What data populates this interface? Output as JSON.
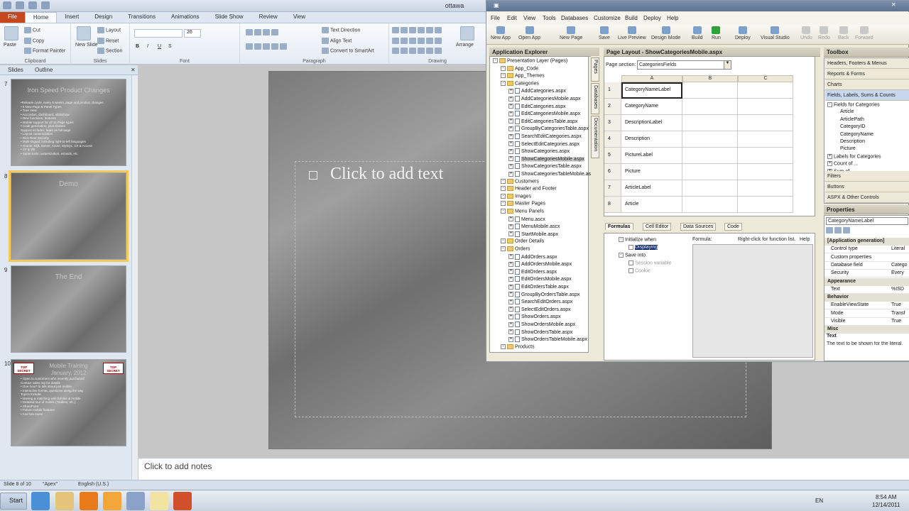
{
  "powerpoint": {
    "title": "ottawa",
    "tabs": [
      "File",
      "Home",
      "Insert",
      "Design",
      "Transitions",
      "Animations",
      "Slide Show",
      "Review",
      "View"
    ],
    "ribbon": {
      "paste": "Paste",
      "cut": "Cut",
      "copy": "Copy",
      "format_painter": "Format Painter",
      "clipboard_label": "Clipboard",
      "new_slide": "New Slide",
      "layout": "Layout",
      "reset": "Reset",
      "section": "Section",
      "slides_label": "Slides",
      "font_label": "Font",
      "paragraph_label": "Paragraph",
      "text_direction": "Text Direction",
      "align_text": "Align Text",
      "convert_smartart": "Convert to SmartArt",
      "arrange": "Arrange",
      "drawing_label": "Drawing",
      "font_size": "26"
    },
    "pane_tabs": [
      "Slides",
      "Outline"
    ],
    "slides": [
      {
        "num": "7",
        "title": "Iron Speed Product Changes",
        "lines": [
          "•Release cycle, every 6 weeks, page and product changes",
          "• 6 New Page & Panel Types",
          "• Tree View",
          "• Accordion, dashboard, slideshow",
          "• New functions, features",
          "• Mobile support for all 31 Page types",
          "• Code generation, plus classes",
          "Support includes, learn as full-page",
          "• Layout customization",
          "• Rich Reel Security",
          "• Multi-lingual, including right-to-left languages",
          "• Oracle, SQL Server, Azure, MySQL, C# & Access",
          "• C# & VB",
          "• Same tools customization, wizards, etc"
        ]
      },
      {
        "num": "8",
        "title": "Demo",
        "lines": []
      },
      {
        "num": "9",
        "title": "The End",
        "lines": []
      },
      {
        "num": "10",
        "title": "Mobile Training\nJanuary, 2012",
        "lines": [
          "• Open to customers who recently purchased",
          "  Contact sales rep for details",
          "• One hour* to talk about just mobile",
          "• Interactive format, questions along the way",
          "Topics Include:",
          "• Moving & matching web full site & mobile",
          "• Detailed tour of mobile (Toolbox, etc.)",
          "• SharePoint",
          "• Future mobile features",
          "• And lots more!"
        ],
        "badge": "TOP SECRET"
      }
    ],
    "slide_placeholder": "Click to add text",
    "notes_placeholder": "Click to add notes",
    "status": {
      "slide": "Slide 8 of 10",
      "theme": "\"Apex\"",
      "language": "English (U.S.)"
    },
    "taskbar": {
      "start": "Start",
      "lang": "EN",
      "time": "8:54 AM",
      "date": "12/14/2011"
    }
  },
  "app": {
    "menu": [
      "File",
      "Edit",
      "View",
      "Tools",
      "Databases",
      "Customize",
      "Build",
      "Deploy",
      "Help"
    ],
    "toolbar": [
      "New App",
      "Open App",
      "New Page",
      "Save",
      "Live Preview",
      "Design Mode",
      "Build",
      "Run",
      "Deploy",
      "Visual Studio",
      "Undo",
      "Redo",
      "Back",
      "Forward"
    ],
    "explorer_title": "Application Explorer",
    "layout_title": "Page Layout - ShowCategoriesMobile.aspx",
    "page_section_label": "Page section:",
    "page_section_value": "CategoriesFields",
    "tree": [
      {
        "lvl": 0,
        "t": "Presentation Layer (Pages)",
        "k": "fd"
      },
      {
        "lvl": 1,
        "t": "App_Code",
        "k": "fd"
      },
      {
        "lvl": 1,
        "t": "App_Themes",
        "k": "fd"
      },
      {
        "lvl": 1,
        "t": "Categories",
        "k": "fd"
      },
      {
        "lvl": 2,
        "t": "AddCategories.aspx",
        "k": "fl"
      },
      {
        "lvl": 2,
        "t": "AddCategoriesMobile.aspx",
        "k": "fl"
      },
      {
        "lvl": 2,
        "t": "EditCategories.aspx",
        "k": "fl"
      },
      {
        "lvl": 2,
        "t": "EditCategoriesMobile.aspx",
        "k": "fl"
      },
      {
        "lvl": 2,
        "t": "EditCategoriesTable.aspx",
        "k": "fl"
      },
      {
        "lvl": 2,
        "t": "GroupByCategoriesTable.aspx",
        "k": "fl"
      },
      {
        "lvl": 2,
        "t": "SearchEditCategories.aspx",
        "k": "fl"
      },
      {
        "lvl": 2,
        "t": "SelectEditCategories.aspx",
        "k": "fl"
      },
      {
        "lvl": 2,
        "t": "ShowCategories.aspx",
        "k": "fl"
      },
      {
        "lvl": 2,
        "t": "ShowCategoriesMobile.aspx",
        "k": "fl",
        "sel": true
      },
      {
        "lvl": 2,
        "t": "ShowCategoriesTable.aspx",
        "k": "fl"
      },
      {
        "lvl": 2,
        "t": "ShowCategoriesTableMobile.aspx",
        "k": "fl"
      },
      {
        "lvl": 1,
        "t": "Customers",
        "k": "fd"
      },
      {
        "lvl": 1,
        "t": "Header and Footer",
        "k": "fd"
      },
      {
        "lvl": 1,
        "t": "Images",
        "k": "fd"
      },
      {
        "lvl": 1,
        "t": "Master Pages",
        "k": "fd"
      },
      {
        "lvl": 1,
        "t": "Menu Panels",
        "k": "fd"
      },
      {
        "lvl": 2,
        "t": "Menu.ascx",
        "k": "fl"
      },
      {
        "lvl": 2,
        "t": "MenuMobile.ascx",
        "k": "fl"
      },
      {
        "lvl": 2,
        "t": "StartMobile.aspx",
        "k": "fl"
      },
      {
        "lvl": 1,
        "t": "Order Details",
        "k": "fd"
      },
      {
        "lvl": 1,
        "t": "Orders",
        "k": "fd"
      },
      {
        "lvl": 2,
        "t": "AddOrders.aspx",
        "k": "fl"
      },
      {
        "lvl": 2,
        "t": "AddOrdersMobile.aspx",
        "k": "fl"
      },
      {
        "lvl": 2,
        "t": "EditOrders.aspx",
        "k": "fl"
      },
      {
        "lvl": 2,
        "t": "EditOrdersMobile.aspx",
        "k": "fl"
      },
      {
        "lvl": 2,
        "t": "EditOrdersTable.aspx",
        "k": "fl"
      },
      {
        "lvl": 2,
        "t": "GroupByOrdersTable.aspx",
        "k": "fl"
      },
      {
        "lvl": 2,
        "t": "SearchEditOrders.aspx",
        "k": "fl"
      },
      {
        "lvl": 2,
        "t": "SelectEditOrders.aspx",
        "k": "fl"
      },
      {
        "lvl": 2,
        "t": "ShowOrders.aspx",
        "k": "fl"
      },
      {
        "lvl": 2,
        "t": "ShowOrdersMobile.aspx",
        "k": "fl"
      },
      {
        "lvl": 2,
        "t": "ShowOrdersTable.aspx",
        "k": "fl"
      },
      {
        "lvl": 2,
        "t": "ShowOrdersTableMobile.aspx",
        "k": "fl"
      },
      {
        "lvl": 1,
        "t": "Products",
        "k": "fd"
      }
    ],
    "side_tabs": [
      "Pages",
      "Databases",
      "Documentation"
    ],
    "grid_cols": [
      "A",
      "B",
      "C"
    ],
    "grid_rows": [
      {
        "n": "1",
        "a": "CategoryNameLabel"
      },
      {
        "n": "2",
        "a": "CategoryName"
      },
      {
        "n": "3",
        "a": "DescriptionLabel"
      },
      {
        "n": "4",
        "a": "Description"
      },
      {
        "n": "5",
        "a": "PictureLabel"
      },
      {
        "n": "6",
        "a": "Picture"
      },
      {
        "n": "7",
        "a": "ArticleLabel"
      },
      {
        "n": "8",
        "a": "Article"
      }
    ],
    "formula_tabs": [
      "Formulas",
      "Cell Editor",
      "Data Sources",
      "Code"
    ],
    "formula_tree": [
      "Initialize when",
      "Displaying",
      "Save into",
      "Session variable",
      "Cookie"
    ],
    "formula_label": "Formula:",
    "formula_hint": "Right-click for function list.",
    "formula_help": "Help",
    "toolbox_title": "Toolbox",
    "toolbox_groups": [
      "Headers, Footers & Menus",
      "Reports & Forms",
      "Charts",
      "Fields, Labels, Sums & Counts"
    ],
    "toolbox_tree": [
      "Fields for Categories",
      "Article",
      "ArticlePath",
      "CategoryID",
      "CategoryName",
      "Description",
      "Picture",
      "Labels for Categories",
      "Count of ...",
      "Sum of ..."
    ],
    "toolbox_bottom": [
      "Filters",
      "Buttons",
      "ASPX & Other Controls"
    ],
    "props_title": "Properties",
    "props_selected": "CategoryNameLabel",
    "props": [
      {
        "cat": "[Application generation]"
      },
      {
        "k": "Control type",
        "v": "Literal"
      },
      {
        "k": "Custom properties",
        "v": ""
      },
      {
        "k": "Database field",
        "v": "Catego"
      },
      {
        "k": "Security",
        "v": "Every"
      },
      {
        "cat": "Appearance"
      },
      {
        "k": "Text",
        "v": "%ISD"
      },
      {
        "cat": "Behavior"
      },
      {
        "k": "EnableViewState",
        "v": "True"
      },
      {
        "k": "Mode",
        "v": "Transf"
      },
      {
        "k": "Visible",
        "v": "True"
      },
      {
        "cat": "Misc"
      }
    ],
    "props_desc_title": "Text",
    "props_desc": "The text to be shown for the literal."
  }
}
